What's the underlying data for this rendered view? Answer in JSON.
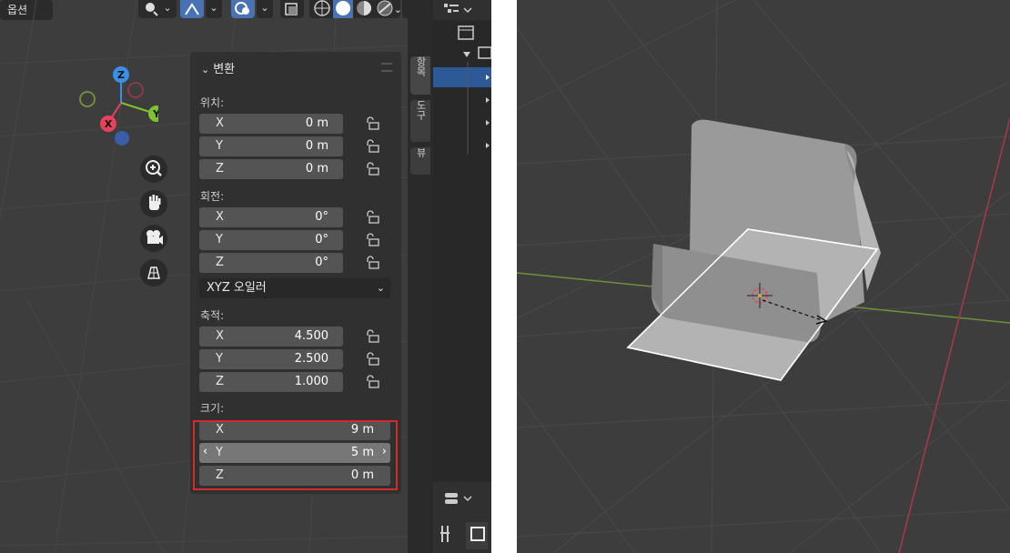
{
  "viewport_header": {
    "options_label": "옵션"
  },
  "gizmo": {
    "x_label": "X",
    "y_label": "Y",
    "z_label": "Z"
  },
  "nav_buttons": [
    "zoom-icon",
    "pan-hand-icon",
    "camera-icon",
    "ortho-grid-icon"
  ],
  "transform_panel": {
    "title": "변환",
    "location": {
      "label": "위치:",
      "rows": [
        {
          "axis": "X",
          "value": "0 m"
        },
        {
          "axis": "Y",
          "value": "0 m"
        },
        {
          "axis": "Z",
          "value": "0 m"
        }
      ]
    },
    "rotation": {
      "label": "회전:",
      "rows": [
        {
          "axis": "X",
          "value": "0°"
        },
        {
          "axis": "Y",
          "value": "0°"
        },
        {
          "axis": "Z",
          "value": "0°"
        }
      ],
      "mode": "XYZ 오일러"
    },
    "scale": {
      "label": "축적:",
      "rows": [
        {
          "axis": "X",
          "value": "4.500"
        },
        {
          "axis": "Y",
          "value": "2.500"
        },
        {
          "axis": "Z",
          "value": "1.000"
        }
      ]
    },
    "dimensions": {
      "label": "크기:",
      "rows": [
        {
          "axis": "X",
          "value": "9 m"
        },
        {
          "axis": "Y",
          "value": "5 m"
        },
        {
          "axis": "Z",
          "value": "0 m"
        }
      ],
      "arrow_left": "‹",
      "arrow_right": "›"
    }
  },
  "side_tabs": [
    "항목",
    "도구",
    "뷰"
  ],
  "colors": {
    "highlight": "#d42a2a",
    "selected_blue": "#4772b3",
    "axis_x": "#e8425a",
    "axis_y": "#7ec32a",
    "axis_z": "#3a8fe8"
  }
}
